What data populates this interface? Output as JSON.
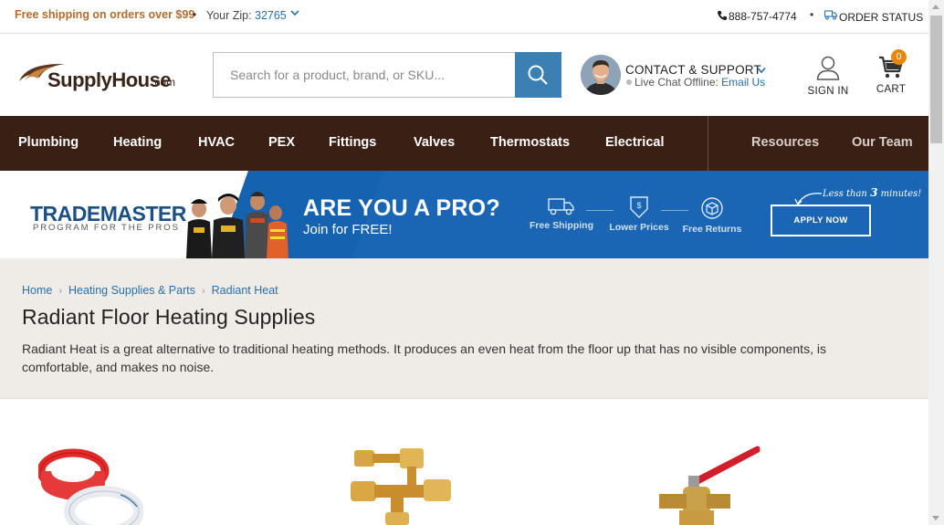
{
  "topbar": {
    "shipping": "Free shipping on orders over $99",
    "zip_label": "Your Zip:",
    "zip_value": "32765",
    "phone": "888-757-4774",
    "order_status": "ORDER STATUS"
  },
  "header": {
    "logo_text": "SupplyHouse",
    "logo_suffix": ".com",
    "search_placeholder": "Search for a product, brand, or SKU...",
    "contact_title": "CONTACT & SUPPORT",
    "chat_status": "Live Chat Offline:",
    "chat_email": "Email Us",
    "sign_in": "SIGN IN",
    "cart": "CART",
    "cart_count": "0"
  },
  "nav": {
    "items": [
      "Plumbing",
      "Heating",
      "HVAC",
      "PEX",
      "Fittings",
      "Valves",
      "Thermostats",
      "Electrical"
    ],
    "secondary": [
      "Resources",
      "Our Team"
    ]
  },
  "banner": {
    "brand": "TRADEMASTER",
    "brand_sub": "PROGRAM FOR THE PROS",
    "headline": "ARE YOU A PRO?",
    "subline": "Join for FREE!",
    "features": [
      "Free Shipping",
      "Lower Prices",
      "Free Returns"
    ],
    "apply": "APPLY NOW",
    "less_prefix": "Less than",
    "less_num": "3",
    "less_suffix": "minutes!"
  },
  "category": {
    "breadcrumbs": [
      "Home",
      "Heating Supplies & Parts",
      "Radiant Heat"
    ],
    "title": "Radiant Floor Heating Supplies",
    "description": "Radiant Heat is a great alternative to traditional heating methods. It produces an even heat from the floor up that has no visible components, is comfortable, and makes no noise."
  },
  "colors": {
    "nav_bg": "#3a1f15",
    "accent_blue": "#3b7fb3",
    "shipping_orange": "#b36a2e",
    "banner_blue": "#1a66b4",
    "cart_badge": "#e8860c"
  },
  "icons": [
    "chevron-down-icon",
    "phone-icon",
    "truck-icon",
    "search-icon",
    "user-icon",
    "cart-icon",
    "shipping-icon",
    "price-tag-icon",
    "returns-icon"
  ]
}
